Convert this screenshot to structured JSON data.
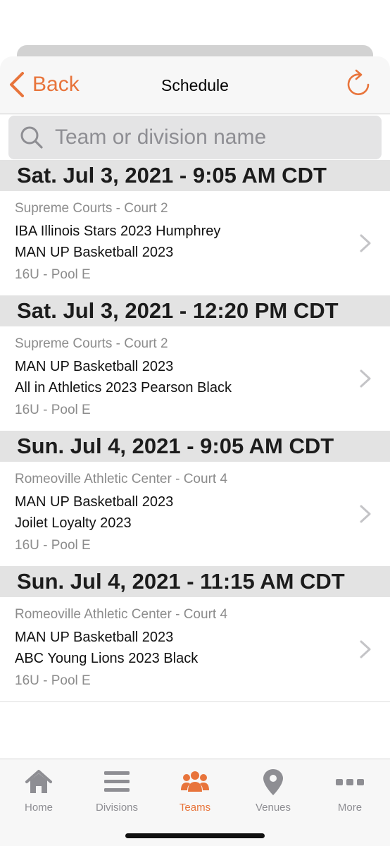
{
  "colors": {
    "accent": "#e8743b",
    "inactive": "#8e8e93",
    "date_bg": "#e3e3e3"
  },
  "header": {
    "back_label": "Back",
    "back_icon": "chevron-left-icon",
    "title": "Schedule",
    "refresh_icon": "refresh-icon"
  },
  "search": {
    "placeholder": "Team or division name",
    "value": "",
    "icon": "search-icon"
  },
  "games": [
    {
      "date": "Sat. Jul 3, 2021 - 9:05 AM CDT",
      "venue": "Supreme Courts - Court 2",
      "team1": "IBA Illinois Stars 2023 Humphrey",
      "team2": "MAN UP Basketball 2023",
      "division": "16U - Pool E"
    },
    {
      "date": "Sat. Jul 3, 2021 - 12:20 PM CDT",
      "venue": "Supreme Courts - Court 2",
      "team1": "MAN UP Basketball 2023",
      "team2": "All in Athletics 2023 Pearson Black",
      "division": "16U - Pool E"
    },
    {
      "date": "Sun. Jul 4, 2021 - 9:05 AM CDT",
      "venue": "Romeoville Athletic Center - Court 4",
      "team1": "MAN UP Basketball 2023",
      "team2": "Joilet Loyalty 2023",
      "division": "16U - Pool E"
    },
    {
      "date": "Sun. Jul 4, 2021 - 11:15 AM CDT",
      "venue": "Romeoville Athletic Center - Court 4",
      "team1": "MAN UP Basketball 2023",
      "team2": "ABC Young Lions 2023 Black",
      "division": "16U - Pool E"
    }
  ],
  "tabbar": {
    "tabs": [
      {
        "label": "Home",
        "icon": "home-icon",
        "active": false
      },
      {
        "label": "Divisions",
        "icon": "list-icon",
        "active": false
      },
      {
        "label": "Teams",
        "icon": "team-icon",
        "active": true
      },
      {
        "label": "Venues",
        "icon": "map-pin-icon",
        "active": false
      },
      {
        "label": "More",
        "icon": "more-icon",
        "active": false
      }
    ]
  }
}
